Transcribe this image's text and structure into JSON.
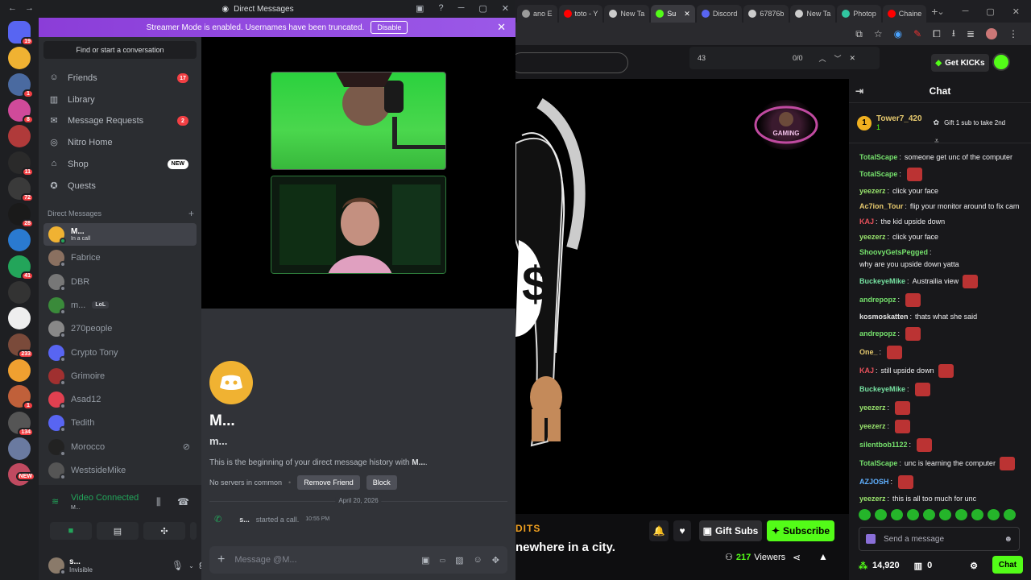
{
  "discord": {
    "window_title": "Direct Messages",
    "banner": {
      "text": "Streamer Mode is enabled. Usernames have been truncated.",
      "button": "Disable"
    },
    "find_conversation": "Find or start a conversation",
    "nav": [
      {
        "label": "Friends",
        "badge": "17"
      },
      {
        "label": "Library",
        "badge": ""
      },
      {
        "label": "Message Requests",
        "badge": "2"
      },
      {
        "label": "Nitro Home",
        "badge": ""
      },
      {
        "label": "Shop",
        "badge": "NEW"
      },
      {
        "label": "Quests",
        "badge": ""
      }
    ],
    "dm_header": "Direct Messages",
    "dms": [
      {
        "name": "M...",
        "sub": "In a call"
      },
      {
        "name": "Fabrice",
        "sub": ""
      },
      {
        "name": "DBR",
        "sub": ""
      },
      {
        "name": "m...",
        "tag": "LoL",
        "sub": ""
      },
      {
        "name": "270people",
        "sub": ""
      },
      {
        "name": "Crypto Tony",
        "sub": ""
      },
      {
        "name": "Grimoire",
        "sub": ""
      },
      {
        "name": "Asad12",
        "sub": ""
      },
      {
        "name": "Tedith",
        "sub": ""
      },
      {
        "name": "Morocco",
        "sub": ""
      },
      {
        "name": "WestsideMike",
        "sub": ""
      }
    ],
    "server_badges": [
      "19",
      "",
      "1",
      "8",
      "",
      "11",
      "72",
      "28",
      "",
      "41",
      "",
      "",
      "233",
      "",
      "1",
      "134",
      "",
      "NEW"
    ],
    "voice": {
      "title": "Video Connected",
      "sub": "M..."
    },
    "user": {
      "name": "s...",
      "status": "Invisible"
    },
    "profile": {
      "name": "M...",
      "handle": "m...",
      "intro_prefix": "This is the beginning of your direct message history with ",
      "intro_name": "M...",
      "intro_suffix": "."
    },
    "actions": {
      "no_servers": "No servers in common",
      "remove_friend": "Remove Friend",
      "block": "Block"
    },
    "date_divider": "April 20, 2026",
    "call_msg": {
      "author": "s...",
      "text": "started a call.",
      "time": "10:55 PM"
    },
    "input_placeholder": "Message @M..."
  },
  "browser": {
    "tabs": [
      {
        "label": "ano E",
        "color": "#9b9b9b"
      },
      {
        "label": "toto - Y",
        "color": "#ff0000"
      },
      {
        "label": "New Ta",
        "color": "#cccccc"
      },
      {
        "label": "Su",
        "color": "#53fc18"
      },
      {
        "label": "Discord",
        "color": "#5865f2"
      },
      {
        "label": "67876b",
        "color": "#cccccc"
      },
      {
        "label": "New Ta",
        "color": "#cccccc"
      },
      {
        "label": "Photop",
        "color": "#31c5a0"
      },
      {
        "label": "Chaine",
        "color": "#ff0000"
      }
    ],
    "find": {
      "query": "43",
      "count": "0/0"
    }
  },
  "kick": {
    "get_kicks": "Get KICKs",
    "chat_title": "Chat",
    "pinned": {
      "rank": "1",
      "user": "Tower7_420",
      "sub": "1",
      "note": "Gift 1 sub to take 2nd"
    },
    "messages": [
      {
        "user": "TotalScape",
        "color": "#75e06c",
        "text": "someone get unc of the computer",
        "emote": false
      },
      {
        "user": "TotalScape",
        "color": "#75e06c",
        "text": "",
        "emote": true
      },
      {
        "user": "yeezerz",
        "color": "#9ae66e",
        "text": "click your face",
        "emote": false
      },
      {
        "user": "Ac7ion_Tour",
        "color": "#e6c96e",
        "text": "flip your monitor around to fix cam",
        "emote": false
      },
      {
        "user": "KAJ",
        "color": "#e6505a",
        "text": "the kid upside down",
        "emote": false
      },
      {
        "user": "yeezerz",
        "color": "#9ae66e",
        "text": "click your face",
        "emote": false
      },
      {
        "user": "ShoovyGetsPegged",
        "color": "#75e06c",
        "text": "why are you upside down yatta",
        "emote": false
      },
      {
        "user": "BuckeyeMike",
        "color": "#75e0a0",
        "text": "Austrailia view",
        "emote": true
      },
      {
        "user": "andrepopz",
        "color": "#75e06c",
        "text": "",
        "emote": true
      },
      {
        "user": "kosmoskatten",
        "color": "#e6e6e6",
        "text": "thats what she said",
        "emote": false
      },
      {
        "user": "andrepopz",
        "color": "#75e06c",
        "text": "",
        "emote": true
      },
      {
        "user": "One_",
        "color": "#e6c96e",
        "text": "",
        "emote": true
      },
      {
        "user": "KAJ",
        "color": "#e6505a",
        "text": "still upside down",
        "emote": true
      },
      {
        "user": "BuckeyeMike",
        "color": "#75e0a0",
        "text": "",
        "emote": true
      },
      {
        "user": "yeezerz",
        "color": "#9ae66e",
        "text": "",
        "emote": true
      },
      {
        "user": "yeezerz",
        "color": "#9ae66e",
        "text": "",
        "emote": true
      },
      {
        "user": "silentbob1122",
        "color": "#75e06c",
        "text": "",
        "emote": true
      },
      {
        "user": "TotalScape",
        "color": "#75e06c",
        "text": "unc is learning the computer",
        "emote": true
      },
      {
        "user": "AZJOSH",
        "color": "#5fb0ff",
        "text": "",
        "emote": true
      },
      {
        "user": "yeezerz",
        "color": "#9ae66e",
        "text": "this is all too much for unc",
        "emote": false
      }
    ],
    "chat_placeholder": "Send a message",
    "points": "14,920",
    "count2": "0",
    "chat_button": "Chat",
    "stream": {
      "credits": "DITS",
      "ticker": "newhere in a city.",
      "gift_subs": "Gift Subs",
      "subscribe": "Subscribe",
      "viewers": "217",
      "viewers_label": "Viewers"
    }
  }
}
